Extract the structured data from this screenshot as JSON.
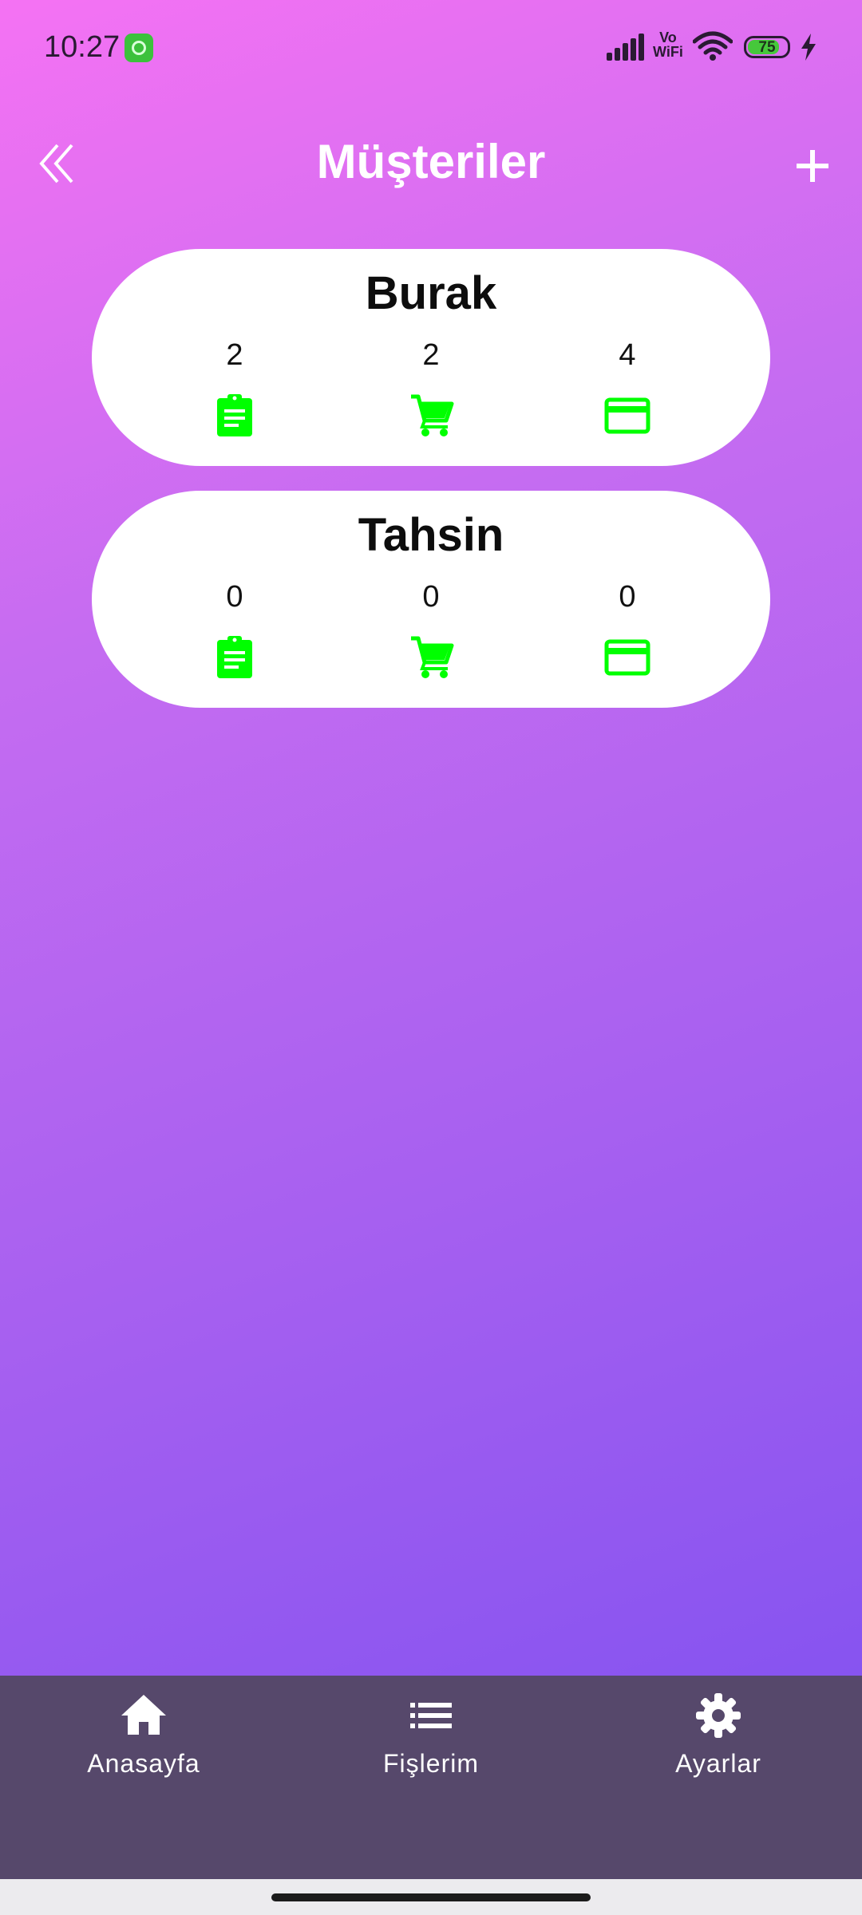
{
  "status_bar": {
    "time": "10:27",
    "network_label_top": "Vo",
    "network_label_bottom": "WiFi",
    "battery_percent": "75",
    "icons": [
      "app-notification-icon",
      "signal-icon",
      "wifi-icon",
      "battery-icon",
      "charging-icon"
    ]
  },
  "header": {
    "title": "Müşteriler",
    "back_icon": "double-chevron-left-icon",
    "add_icon": "plus-icon"
  },
  "customers": [
    {
      "name": "Burak",
      "receipts": "2",
      "cart": "2",
      "payments": "4"
    },
    {
      "name": "Tahsin",
      "receipts": "0",
      "cart": "0",
      "payments": "0"
    }
  ],
  "stat_icons": {
    "receipts": "clipboard-icon",
    "cart": "shopping-cart-icon",
    "payments": "credit-card-icon"
  },
  "colors": {
    "accent_green": "#00ff00",
    "nav_background": "#56486b",
    "gradient_top": "#f572f3",
    "gradient_bottom": "#7b4ff0"
  },
  "bottom_nav": {
    "items": [
      {
        "label": "Anasayfa",
        "icon": "home-icon"
      },
      {
        "label": "Fişlerim",
        "icon": "list-icon"
      },
      {
        "label": "Ayarlar",
        "icon": "gear-icon"
      }
    ]
  }
}
